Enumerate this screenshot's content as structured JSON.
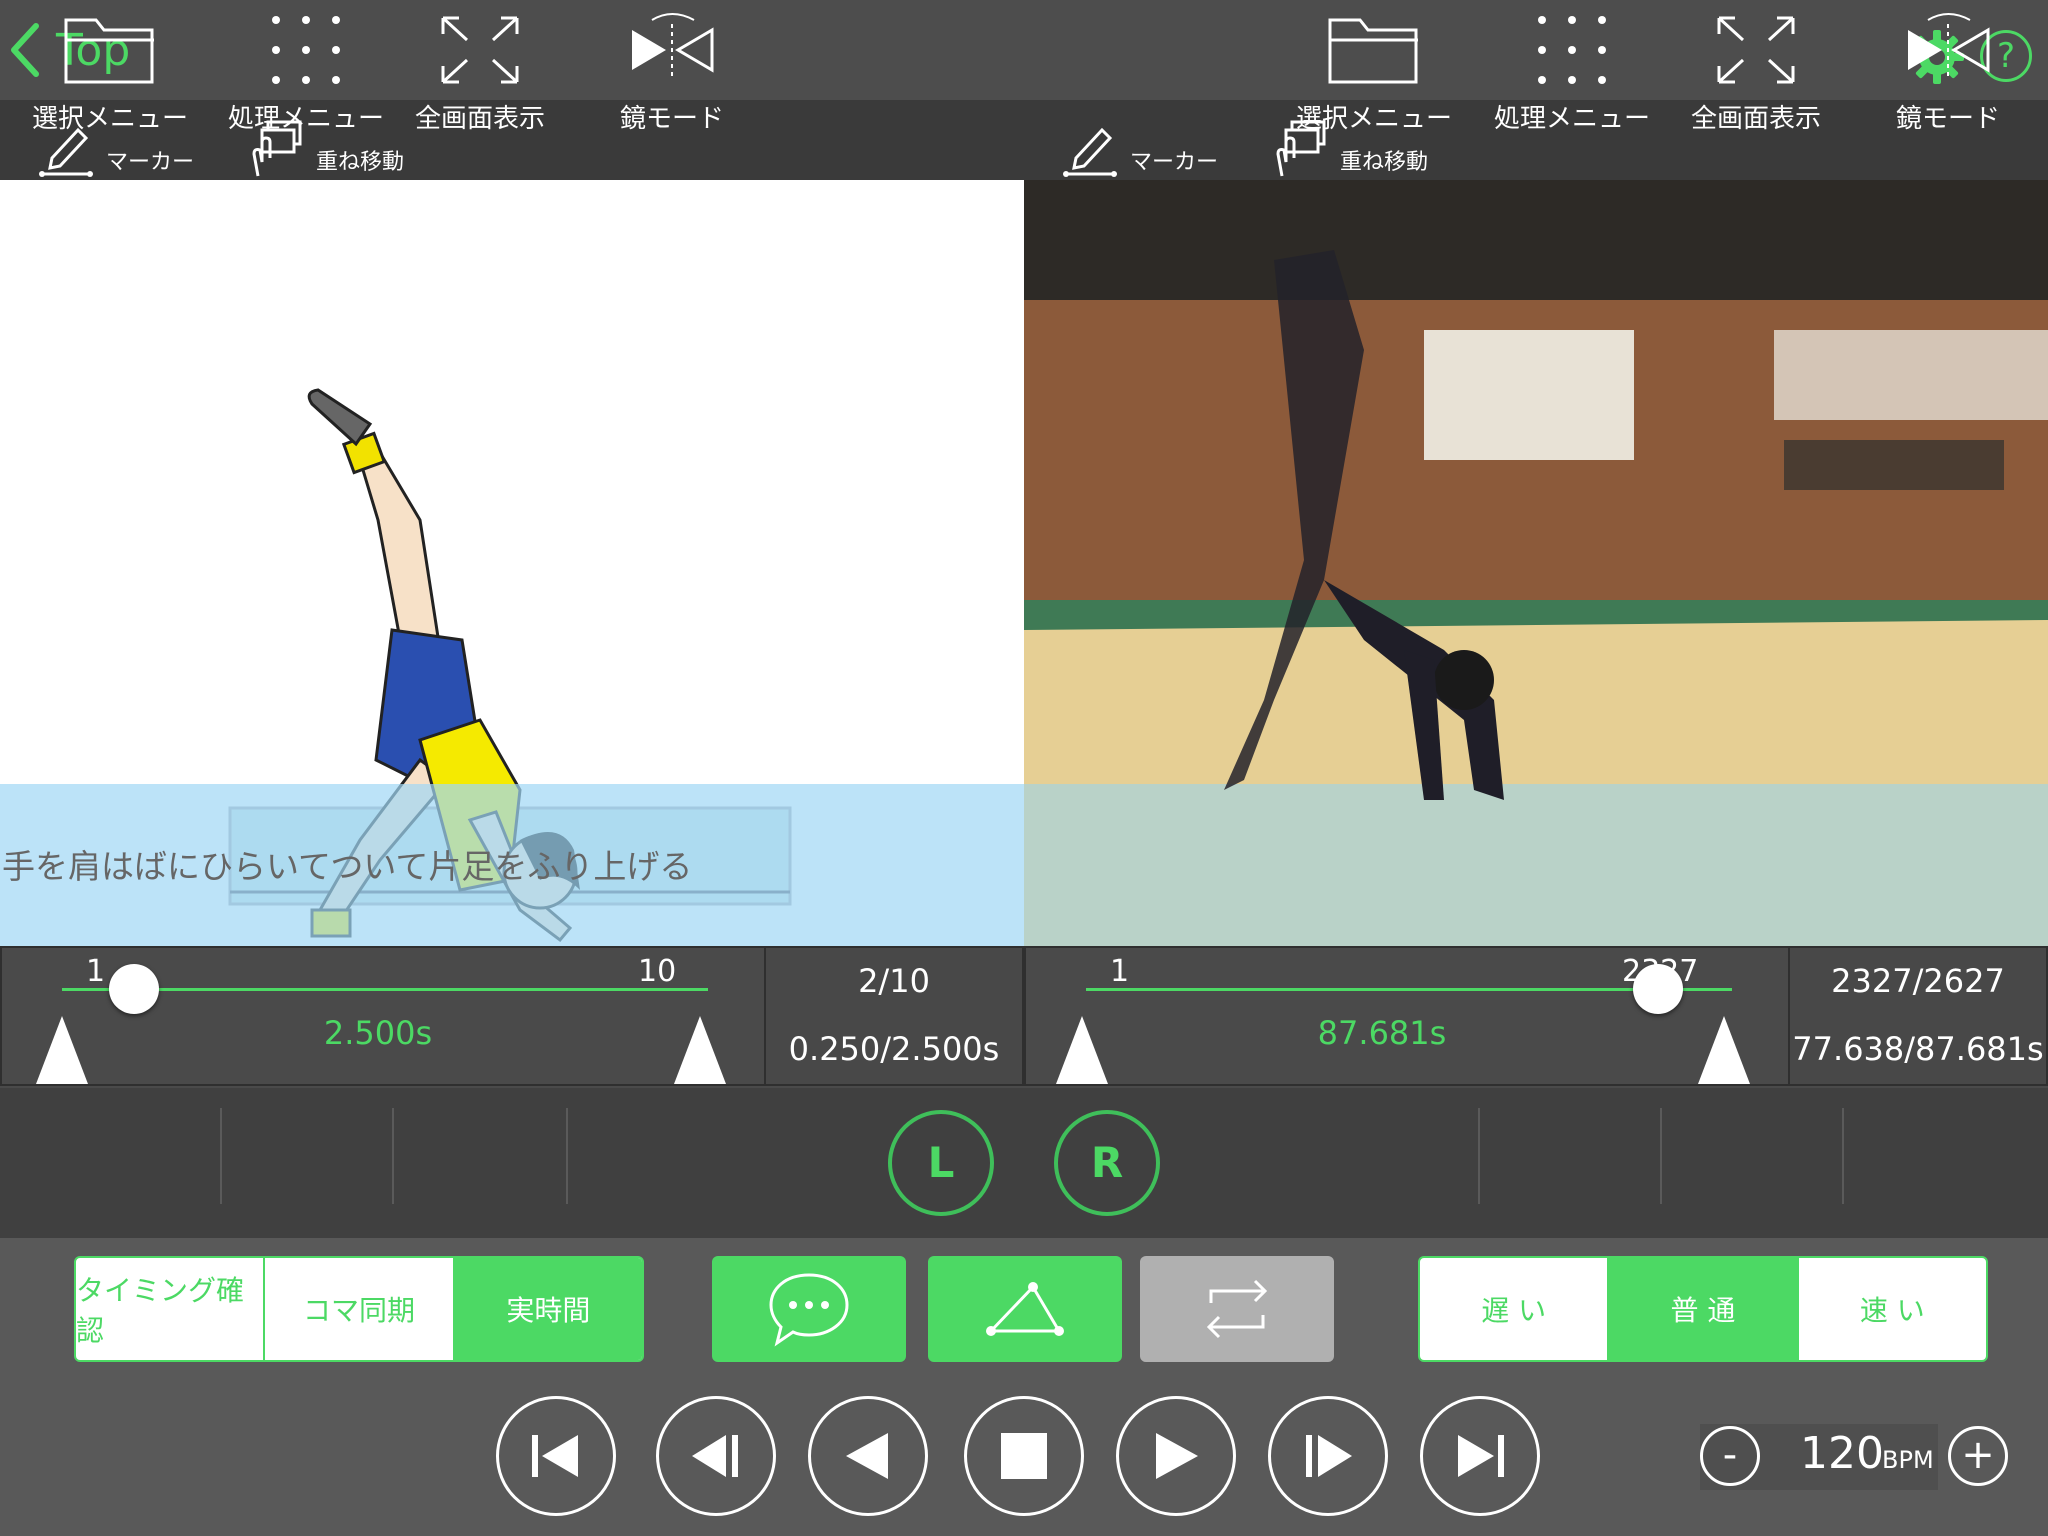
{
  "nav": {
    "back_label": "Top"
  },
  "left": {
    "toolbar": {
      "marker_label": "マーカー",
      "overlay_label": "重ね移動"
    },
    "caption": "手を肩はばにひらいてついて片足をふり上げる",
    "slider": {
      "min_label": "1",
      "max_label": "10",
      "time": "2.500s",
      "position_fraction": 0.111
    },
    "info": {
      "frame": "2/10",
      "time": "0.250/2.500s"
    },
    "menu": {
      "select": "選択メニュー",
      "process": "処理メニュー",
      "fullscreen": "全画面表示",
      "mirror": "鏡モード"
    },
    "channel_button": "L"
  },
  "right": {
    "toolbar": {
      "marker_label": "マーカー",
      "overlay_label": "重ね移動"
    },
    "slider": {
      "min_label": "1",
      "max_label": "2327",
      "time": "87.681s",
      "position_fraction": 0.886
    },
    "info": {
      "frame": "2327/2627",
      "time": "77.638/87.681s"
    },
    "menu": {
      "select": "選択メニュー",
      "process": "処理メニュー",
      "fullscreen": "全画面表示",
      "mirror": "鏡モード"
    },
    "channel_button": "R"
  },
  "sync_mode": {
    "options": [
      "タイミング確認",
      "コマ同期",
      "実時間"
    ],
    "selected": "実時間"
  },
  "speed": {
    "options": [
      "遅 い",
      "普 通",
      "速 い"
    ],
    "selected": "普 通"
  },
  "bpm": {
    "minus": "-",
    "plus": "+",
    "value": "120",
    "unit": "BPM"
  },
  "colors": {
    "accent": "#4cd964",
    "bar": "#4d4d4d",
    "caption_band": "#a0d7f5"
  },
  "icons": [
    "chevron-left-icon",
    "gear-icon",
    "help-icon",
    "pen-icon",
    "overlay-move-icon",
    "folder-icon",
    "dots-grid-icon",
    "expand-icon",
    "mirror-icon",
    "speech-bubble-icon",
    "angle-icon",
    "loop-icon",
    "skip-start-icon",
    "step-back-icon",
    "play-reverse-icon",
    "stop-icon",
    "play-icon",
    "step-forward-icon",
    "skip-end-icon"
  ]
}
